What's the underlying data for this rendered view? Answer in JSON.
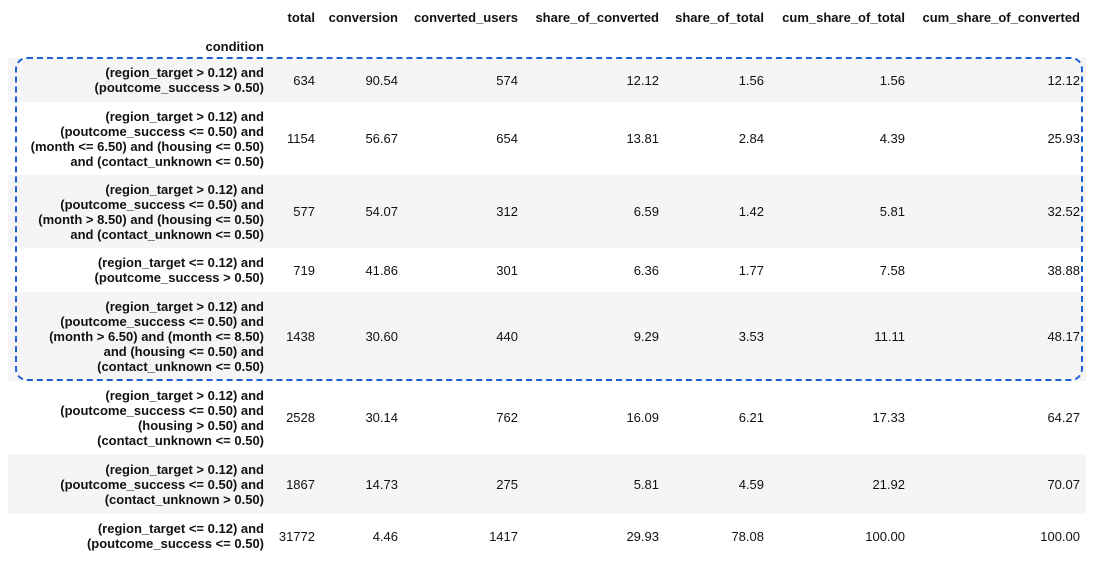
{
  "columns": [
    "total",
    "conversion",
    "converted_users",
    "share_of_converted",
    "share_of_total",
    "cum_share_of_total",
    "cum_share_of_converted"
  ],
  "index_name": "condition",
  "rows": [
    {
      "condition": [
        "(region_target > 0.12) and",
        "(poutcome_success > 0.50)"
      ],
      "values": [
        "634",
        "90.54",
        "574",
        "12.12",
        "1.56",
        "1.56",
        "12.12"
      ]
    },
    {
      "condition": [
        "(region_target > 0.12) and",
        "(poutcome_success <= 0.50) and",
        "(month <= 6.50) and (housing <= 0.50)",
        "and (contact_unknown <= 0.50)"
      ],
      "values": [
        "1154",
        "56.67",
        "654",
        "13.81",
        "2.84",
        "4.39",
        "25.93"
      ]
    },
    {
      "condition": [
        "(region_target > 0.12) and",
        "(poutcome_success <= 0.50) and",
        "(month > 8.50) and (housing <= 0.50)",
        "and (contact_unknown <= 0.50)"
      ],
      "values": [
        "577",
        "54.07",
        "312",
        "6.59",
        "1.42",
        "5.81",
        "32.52"
      ]
    },
    {
      "condition": [
        "(region_target <= 0.12) and",
        "(poutcome_success > 0.50)"
      ],
      "values": [
        "719",
        "41.86",
        "301",
        "6.36",
        "1.77",
        "7.58",
        "38.88"
      ]
    },
    {
      "condition": [
        "(region_target > 0.12) and",
        "(poutcome_success <= 0.50) and",
        "(month > 6.50) and (month <= 8.50)",
        "and (housing <= 0.50) and",
        "(contact_unknown <= 0.50)"
      ],
      "values": [
        "1438",
        "30.60",
        "440",
        "9.29",
        "3.53",
        "11.11",
        "48.17"
      ]
    },
    {
      "condition": [
        "(region_target > 0.12) and",
        "(poutcome_success <= 0.50) and",
        "(housing > 0.50) and",
        "(contact_unknown <= 0.50)"
      ],
      "values": [
        "2528",
        "30.14",
        "762",
        "16.09",
        "6.21",
        "17.33",
        "64.27"
      ]
    },
    {
      "condition": [
        "(region_target > 0.12) and",
        "(poutcome_success <= 0.50) and",
        "(contact_unknown > 0.50)"
      ],
      "values": [
        "1867",
        "14.73",
        "275",
        "5.81",
        "4.59",
        "21.92",
        "70.07"
      ]
    },
    {
      "condition": [
        "(region_target <= 0.12) and",
        "(poutcome_success <= 0.50)"
      ],
      "values": [
        "31772",
        "4.46",
        "1417",
        "29.93",
        "78.08",
        "100.00",
        "100.00"
      ]
    }
  ],
  "highlight_color": "#1f5fd6"
}
